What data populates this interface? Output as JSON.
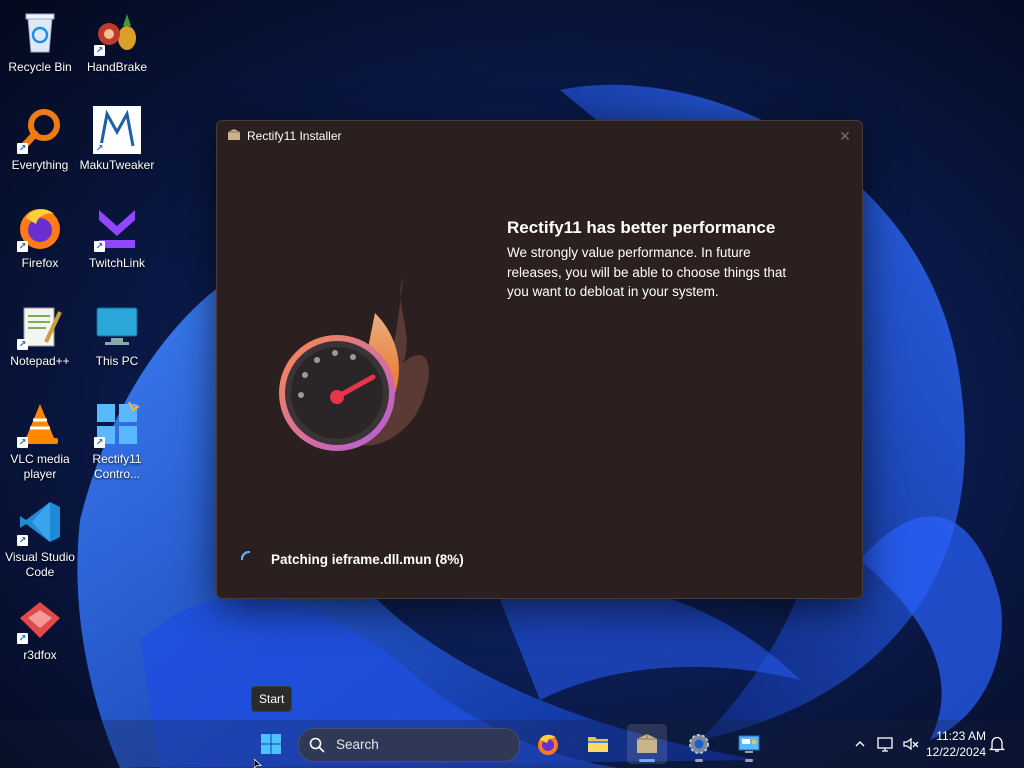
{
  "desktop": {
    "icons": [
      {
        "label": "Recycle Bin",
        "icon": "recycle-bin-icon"
      },
      {
        "label": "HandBrake",
        "icon": "handbrake-icon"
      },
      {
        "label": "Everything",
        "icon": "everything-icon"
      },
      {
        "label": "MakuTweaker",
        "icon": "makutweaker-icon"
      },
      {
        "label": "Firefox",
        "icon": "firefox-icon"
      },
      {
        "label": "TwitchLink",
        "icon": "twitchlink-icon"
      },
      {
        "label": "Notepad++",
        "icon": "notepadpp-icon"
      },
      {
        "label": "This PC",
        "icon": "this-pc-icon"
      },
      {
        "label": "VLC media player",
        "icon": "vlc-icon"
      },
      {
        "label": "Rectify11 Contro...",
        "icon": "rectify11-control-icon"
      },
      {
        "label": "Visual Studio Code",
        "icon": "vscode-icon"
      },
      {
        "label": "r3dfox",
        "icon": "r3dfox-icon"
      }
    ]
  },
  "installer": {
    "title": "Rectify11 Installer",
    "headline": "Rectify11 has better performance",
    "description": "We strongly value performance. In future releases, you will be able to choose things that you want to debloat in your system.",
    "status": "Patching ieframe.dll.mun (8%)",
    "progress_percent": 8,
    "close_icon": "close-icon",
    "hero_icon": "speedometer-fire-icon"
  },
  "tooltip": {
    "text": "Start"
  },
  "taskbar": {
    "search_placeholder": "Search",
    "apps": [
      {
        "name": "start",
        "icon": "windows-start-icon"
      },
      {
        "name": "firefox",
        "icon": "firefox-icon"
      },
      {
        "name": "file-explorer",
        "icon": "folder-icon"
      },
      {
        "name": "rectify11-installer",
        "icon": "installer-box-icon",
        "active": true
      },
      {
        "name": "settings",
        "icon": "gear-icon"
      },
      {
        "name": "control-panel",
        "icon": "control-panel-icon"
      }
    ],
    "clock": {
      "time": "11:23 AM",
      "date": "12/22/2024"
    }
  },
  "colors": {
    "window_bg": "#2b1f1f",
    "accent": "#5fb2ff",
    "wallpaper_dark": "#050d2a",
    "wallpaper_blue": "#1a4fd6"
  }
}
